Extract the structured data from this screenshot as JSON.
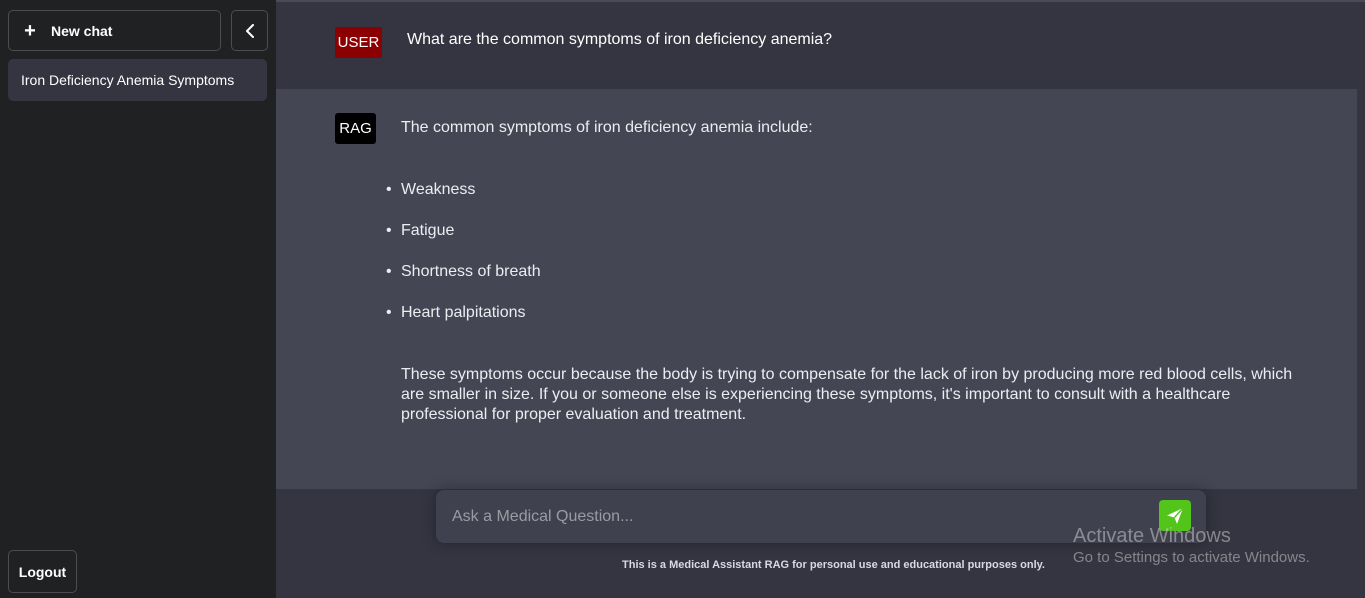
{
  "sidebar": {
    "new_chat_label": "New chat",
    "chats": [
      {
        "title": "Iron Deficiency Anemia Symptoms"
      }
    ],
    "logout_label": "Logout"
  },
  "conversation": {
    "user_badge": "USER",
    "user_message": "What are the common symptoms of iron deficiency anemia?",
    "assistant_badge": "RAG",
    "assistant_intro": "The common symptoms of iron deficiency anemia include:",
    "assistant_list": [
      "Weakness",
      "Fatigue",
      "Shortness of breath",
      "Heart palpitations"
    ],
    "assistant_outro": "These symptoms occur because the body is trying to compensate for the lack of iron by producing more red blood cells, which are smaller in size. If you or someone else is experiencing these symptoms, it's important to consult with a healthcare professional for proper evaluation and treatment."
  },
  "composer": {
    "placeholder": "Ask a Medical Question...",
    "send_icon": "paper-plane-icon"
  },
  "footer_note": "This is a Medical Assistant RAG for personal use and educational purposes only.",
  "watermark": {
    "title": "Activate Windows",
    "subtitle": "Go to Settings to activate Windows."
  },
  "colors": {
    "sidebar_bg": "#202123",
    "main_bg": "#343541",
    "assistant_bg": "#444654",
    "user_badge_bg": "#8b0000",
    "rag_badge_bg": "#000000",
    "send_button": "#52c41a"
  }
}
